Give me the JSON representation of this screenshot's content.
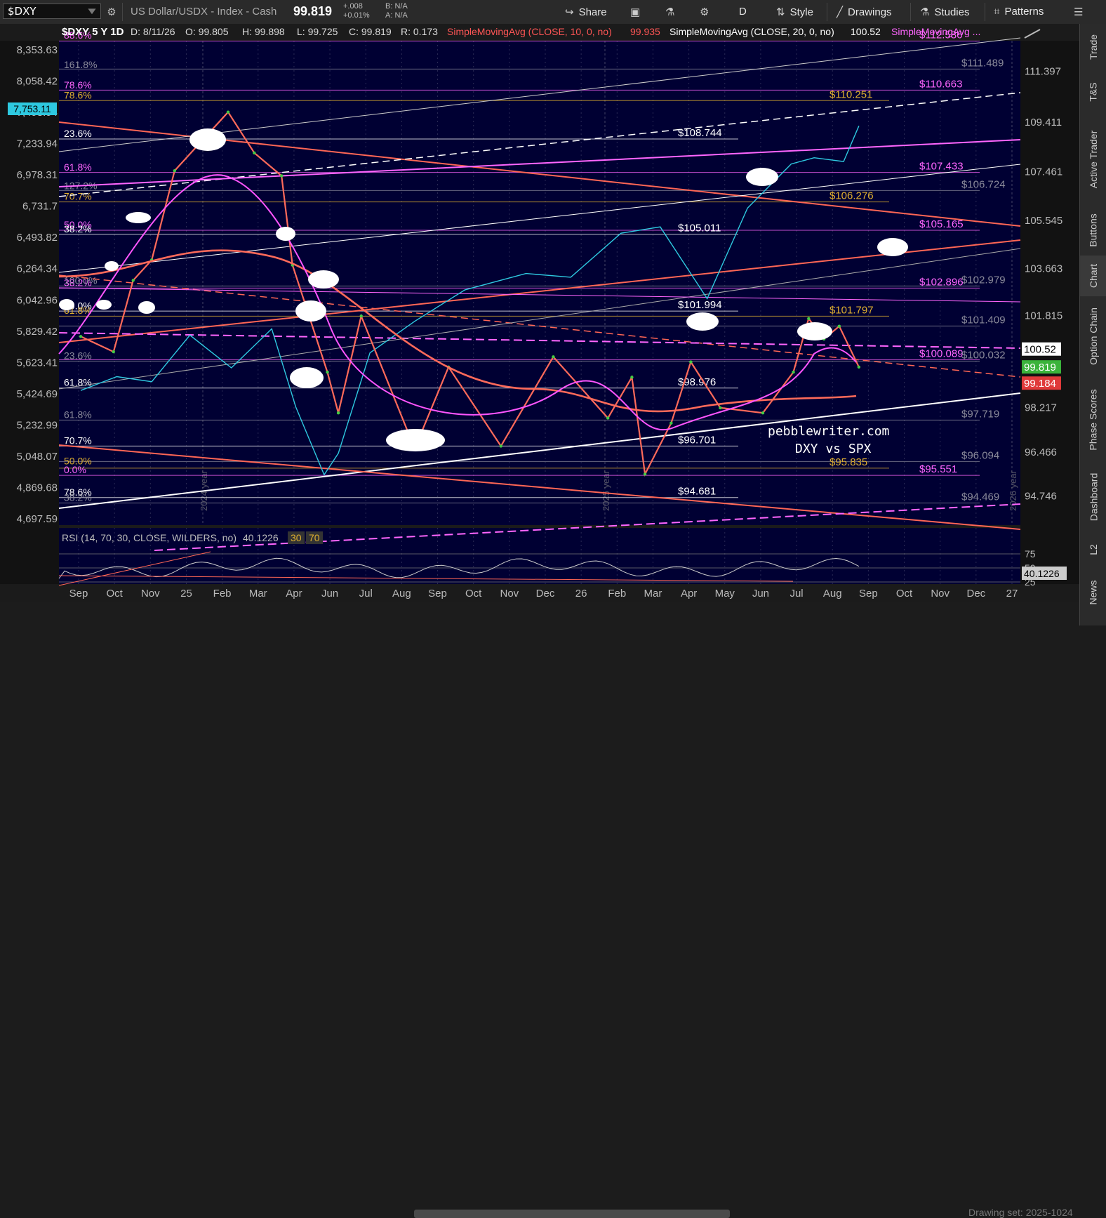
{
  "toolbar": {
    "symbol": "$DXY",
    "name": "US Dollar/USDX - Index - Cash",
    "last": "99.819",
    "change": "+.008",
    "change_pct": "+0.01%",
    "bid": "B: N/A",
    "ask": "A: N/A",
    "share": "Share",
    "period": "D",
    "style": "Style",
    "drawings": "Drawings",
    "studies": "Studies",
    "patterns": "Patterns"
  },
  "side_tabs": [
    "Trade",
    "T&S",
    "Active Trader",
    "Buttons",
    "Chart",
    "Option Chain",
    "Phase Scores",
    "Dashboard",
    "L2",
    "News"
  ],
  "bottom": {
    "drawing_set": "Drawing set: 2025-1024"
  },
  "chart_data": {
    "type": "line",
    "main_header": {
      "symbol": "$DXY 5 Y 1D",
      "date": "D: 8/11/26",
      "open": "O: 99.805",
      "high": "H: 99.898",
      "low": "L: 99.725",
      "close": "C: 99.819",
      "range": "R: 0.173",
      "sma10": "SimpleMovingAvg (CLOSE, 10, 0, no)",
      "sma10_val": "99.935",
      "sma20": "SimpleMovingAvg (CLOSE, 20, 0, no)",
      "sma20_val": "100.52",
      "sma_more": "SimpleMovingAvg ..."
    },
    "x_ticks": [
      "Sep",
      "Oct",
      "Nov",
      "25",
      "Feb",
      "Mar",
      "Apr",
      "Jun",
      "Jul",
      "Aug",
      "Sep",
      "Oct",
      "Nov",
      "Dec",
      "26",
      "Feb",
      "Mar",
      "Apr",
      "May",
      "Jun",
      "Jul",
      "Aug",
      "Sep",
      "Oct",
      "Nov",
      "Dec",
      "27"
    ],
    "year_labels": [
      "2024 year",
      "2025 year",
      "2026 year"
    ],
    "right_axis": {
      "labels": [
        "111.397",
        "109.411",
        "107.461",
        "105.545",
        "103.663",
        "101.815",
        "98.217",
        "96.466",
        "94.746"
      ],
      "ylim": [
        93.6,
        112.6
      ]
    },
    "left_axis": {
      "labels": [
        "8,353.63",
        "8,058.42",
        "7,498.94",
        "7,233.94",
        "6,978.31",
        "6,731.7",
        "6,493.82",
        "6,264.34",
        "6,042.96",
        "5,829.42",
        "5,623.41",
        "5,424.69",
        "5,232.99",
        "5,048.07",
        "4,869.68",
        "4,697.59"
      ],
      "highlight": "7,753.11"
    },
    "price_tags": [
      {
        "label": "100.52",
        "color": "#ffffff",
        "text_color": "#000000",
        "value": 100.52
      },
      {
        "label": "99.819",
        "color": "#3bb33b",
        "text_color": "#ffffff",
        "value": 99.819
      },
      {
        "label": "99.184",
        "color": "#e03a3a",
        "text_color": "#ffffff",
        "value": 99.184
      }
    ],
    "levels": [
      {
        "label": "$112.586",
        "color": "#ff66ff",
        "value": 112.586
      },
      {
        "label": "$111.489",
        "color": "#8a8a9a",
        "value": 111.489
      },
      {
        "label": "$110.663",
        "color": "#ff66ff",
        "value": 110.663
      },
      {
        "label": "$110.251",
        "color": "#e0b030",
        "value": 110.251
      },
      {
        "label": "$108.744",
        "color": "#ffffff",
        "value": 108.744
      },
      {
        "label": "$107.433",
        "color": "#ff66ff",
        "value": 107.433
      },
      {
        "label": "$106.724",
        "color": "#8a8a9a",
        "value": 106.724
      },
      {
        "label": "$106.276",
        "color": "#e0b030",
        "value": 106.276
      },
      {
        "label": "$105.165",
        "color": "#ff66ff",
        "value": 105.165
      },
      {
        "label": "$105.011",
        "color": "#ffffff",
        "value": 105.011
      },
      {
        "label": "$102.979",
        "color": "#8a8a9a",
        "value": 102.979
      },
      {
        "label": "$102.896",
        "color": "#ff66ff",
        "value": 102.896
      },
      {
        "label": "$101.994",
        "color": "#ffffff",
        "value": 101.994
      },
      {
        "label": "$101.797",
        "color": "#e0b030",
        "value": 101.797
      },
      {
        "label": "$101.409",
        "color": "#8a8a9a",
        "value": 101.409
      },
      {
        "label": "$100.089",
        "color": "#ff66ff",
        "value": 100.089
      },
      {
        "label": "$100.032",
        "color": "#8a8a9a",
        "value": 100.032
      },
      {
        "label": "$98.976",
        "color": "#ffffff",
        "value": 98.976
      },
      {
        "label": "$97.719",
        "color": "#8a8a9a",
        "value": 97.719
      },
      {
        "label": "$96.701",
        "color": "#ffffff",
        "value": 96.701
      },
      {
        "label": "$96.094",
        "color": "#8a8a9a",
        "value": 96.094
      },
      {
        "label": "$95.835",
        "color": "#e0b030",
        "value": 95.835
      },
      {
        "label": "$95.551",
        "color": "#ff66ff",
        "value": 95.551
      },
      {
        "label": "$94.681",
        "color": "#ffffff",
        "value": 94.681
      },
      {
        "label": "$94.469",
        "color": "#8a8a9a",
        "value": 94.469
      }
    ],
    "fib_labels": [
      {
        "label": "88.6%",
        "color": "#ff66ff",
        "value": 112.6
      },
      {
        "label": "161.8%",
        "color": "#8a8a9a",
        "value": 111.45
      },
      {
        "label": "78.6%",
        "color": "#ff66ff",
        "value": 110.65
      },
      {
        "label": "78.6%",
        "color": "#e0b030",
        "value": 110.25
      },
      {
        "label": "23.6%",
        "color": "#ffffff",
        "value": 108.74
      },
      {
        "label": "61.8%",
        "color": "#ff66ff",
        "value": 107.43
      },
      {
        "label": "127.2%",
        "color": "#8a8a9a",
        "value": 106.7
      },
      {
        "label": "70.7%",
        "color": "#e0b030",
        "value": 106.28
      },
      {
        "label": "50.0%",
        "color": "#ff66ff",
        "value": 105.16
      },
      {
        "label": "38.2%",
        "color": "#ffffff",
        "value": 105.0
      },
      {
        "label": "38.2%",
        "color": "#ff66ff",
        "value": 102.9
      },
      {
        "label": "100.0%",
        "color": "#8a8a9a",
        "value": 102.98
      },
      {
        "label": "50.0%",
        "color": "#ffffff",
        "value": 101.99
      },
      {
        "label": "61.8%",
        "color": "#e0b030",
        "value": 101.8
      },
      {
        "label": "23.6%",
        "color": "#8a8a9a",
        "value": 100.03
      },
      {
        "label": "61.8%",
        "color": "#ffffff",
        "value": 98.98
      },
      {
        "label": "61.8%",
        "color": "#8a8a9a",
        "value": 97.72
      },
      {
        "label": "70.7%",
        "color": "#ffffff",
        "value": 96.7
      },
      {
        "label": "50.0%",
        "color": "#e0b030",
        "value": 95.9
      },
      {
        "label": "0.0%",
        "color": "#ff66ff",
        "value": 95.55
      },
      {
        "label": "78.6%",
        "color": "#ffffff",
        "value": 94.68
      },
      {
        "label": "38.2%",
        "color": "#8a8a9a",
        "value": 94.47
      }
    ],
    "dxy_key_points": [
      {
        "x": "2024-08-28",
        "y": 101.0
      },
      {
        "x": "2024-09-27",
        "y": 100.4
      },
      {
        "x": "2024-10-15",
        "y": 103.2
      },
      {
        "x": "2024-11-01",
        "y": 104.0
      },
      {
        "x": "2024-11-22",
        "y": 107.5
      },
      {
        "x": "2025-01-10",
        "y": 109.8
      },
      {
        "x": "2025-02-03",
        "y": 108.2
      },
      {
        "x": "2025-02-28",
        "y": 107.3
      },
      {
        "x": "2025-03-10",
        "y": 103.8
      },
      {
        "x": "2025-04-11",
        "y": 99.6
      },
      {
        "x": "2025-04-21",
        "y": 98.0
      },
      {
        "x": "2025-05-12",
        "y": 101.8
      },
      {
        "x": "2025-06-30",
        "y": 96.6
      },
      {
        "x": "2025-07-31",
        "y": 99.8
      },
      {
        "x": "2025-09-17",
        "y": 96.7
      },
      {
        "x": "2025-11-04",
        "y": 100.2
      },
      {
        "x": "2025-12-24",
        "y": 97.8
      },
      {
        "x": "2026-01-15",
        "y": 99.4
      },
      {
        "x": "2026-01-27",
        "y": 95.6
      },
      {
        "x": "2026-02-20",
        "y": 97.6
      },
      {
        "x": "2026-03-10",
        "y": 100.0
      },
      {
        "x": "2026-04-06",
        "y": 98.2
      },
      {
        "x": "2026-05-15",
        "y": 98.0
      },
      {
        "x": "2026-06-12",
        "y": 99.6
      },
      {
        "x": "2026-06-26",
        "y": 101.7
      },
      {
        "x": "2026-07-10",
        "y": 100.9
      },
      {
        "x": "2026-07-24",
        "y": 101.4
      },
      {
        "x": "2026-08-11",
        "y": 99.8
      }
    ],
    "spx_key_points": [
      {
        "x": "2024-08-28",
        "y": 5650
      },
      {
        "x": "2024-09-30",
        "y": 5760
      },
      {
        "x": "2024-11-01",
        "y": 5720
      },
      {
        "x": "2024-12-06",
        "y": 6090
      },
      {
        "x": "2025-01-13",
        "y": 5830
      },
      {
        "x": "2025-02-19",
        "y": 6140
      },
      {
        "x": "2025-03-13",
        "y": 5520
      },
      {
        "x": "2025-04-08",
        "y": 4980
      },
      {
        "x": "2025-04-21",
        "y": 5150
      },
      {
        "x": "2025-05-20",
        "y": 5950
      },
      {
        "x": "2025-06-30",
        "y": 6200
      },
      {
        "x": "2025-08-15",
        "y": 6450
      },
      {
        "x": "2025-10-10",
        "y": 6580
      },
      {
        "x": "2025-11-20",
        "y": 6550
      },
      {
        "x": "2026-01-05",
        "y": 6900
      },
      {
        "x": "2026-02-10",
        "y": 6950
      },
      {
        "x": "2026-03-25",
        "y": 6380
      },
      {
        "x": "2026-05-01",
        "y": 7100
      },
      {
        "x": "2026-06-10",
        "y": 7450
      },
      {
        "x": "2026-07-01",
        "y": 7500
      },
      {
        "x": "2026-07-28",
        "y": 7470
      },
      {
        "x": "2026-08-11",
        "y": 7753
      }
    ],
    "watermark_1": "pebblewriter.com",
    "watermark_2": "DXY  vs  SPX",
    "rsi": {
      "header": "RSI (14, 70, 30, CLOSE, WILDERS, no)",
      "value": "40.1226",
      "oversold": "30",
      "overbought": "70",
      "axis_labels": [
        "75",
        "50",
        "25"
      ]
    }
  }
}
